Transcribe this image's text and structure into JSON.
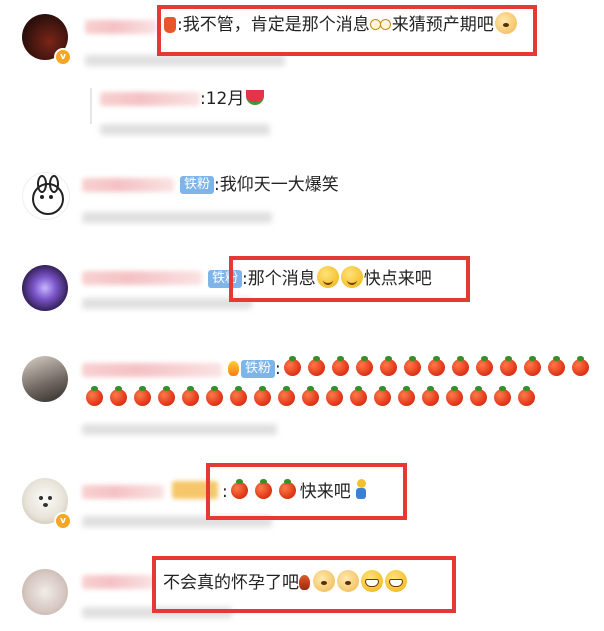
{
  "comments": [
    {
      "id": 1,
      "text": "我不管，肯定是那个消息",
      "text_after_emoji": "来猜预产期吧"
    },
    {
      "id": "reply",
      "text": ":12月"
    },
    {
      "id": 2,
      "badge": "铁粉",
      "text": ":我仰天一大爆笑"
    },
    {
      "id": 3,
      "badge": "铁粉",
      "text": ":那个消息",
      "text_after_emoji": "快点来吧"
    },
    {
      "id": 4,
      "badge": "铁粉",
      "prefix": ":",
      "tomato_row1": 13,
      "tomato_row2": 19
    },
    {
      "id": 5,
      "prefix": ":",
      "tomatoes": 3,
      "text_after_emoji": "快来吧"
    },
    {
      "id": 6,
      "text": "不会真的怀孕了吧"
    }
  ],
  "icons": {
    "verified_badge": "v-badge-icon",
    "tomato": "tomato-emoji",
    "grin": "grin-emoji",
    "shy": "shy-face-emoji",
    "dog": "dog-face-emoji",
    "watermelon": "watermelon-emoji",
    "glasses": "glasses-emoji",
    "runner": "running-person-emoji"
  },
  "colors": {
    "highlight": "#e53935",
    "badge": "#7fb4e8",
    "verified": "#f5a623"
  }
}
